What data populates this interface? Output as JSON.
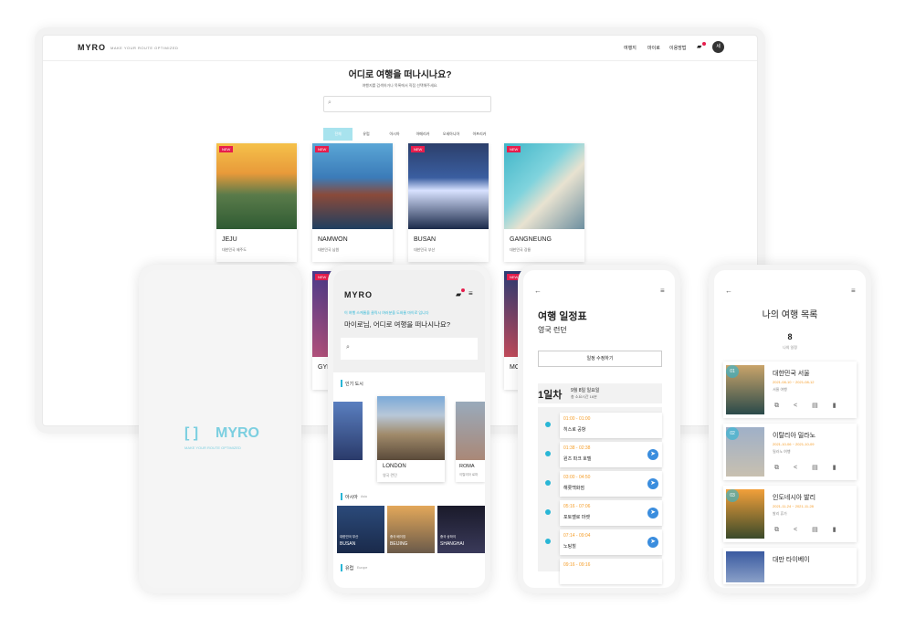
{
  "desktop": {
    "logo": "MYRO",
    "tagline": "MAKE YOUR ROUTE OPTIMIZED",
    "nav": [
      "여행지",
      "마이로",
      "이용방법"
    ],
    "avatar": "세",
    "heading": "어디로 여행을 떠나시나요?",
    "subheading": "여행지를 검색하거나 목록에서 직접 선택해주세요.",
    "search_placeholder": "",
    "filters": [
      "전체",
      "유럽",
      "아시아",
      "아메리카",
      "오세아니아",
      "아프리카"
    ],
    "badge": "NEW",
    "cards": [
      {
        "name": "JEJU",
        "sub": "대한민국 제주도"
      },
      {
        "name": "NAMWON",
        "sub": "대한민국 남원"
      },
      {
        "name": "BUSAN",
        "sub": "대한민국 부산"
      },
      {
        "name": "GANGNEUNG",
        "sub": "대한민국 강릉"
      }
    ],
    "row2_names": [
      "GYI",
      "MO"
    ]
  },
  "splash": {
    "logo": "MYRO",
    "tagline": "MAKE YOUR ROUTE OPTIMIZED"
  },
  "home": {
    "logo": "MYRO",
    "notice": "이 여행 스케줄을 클릭시 여러분을 도와줄 마이로 입니다",
    "heading": "마이로님, 어디로 여행을 떠나시나요?",
    "popular": "인기 도시",
    "main_city": "LONDON",
    "main_city_sub": "영국 런던",
    "right_city": "ROMA",
    "right_city_sub": "이탈리아 로마",
    "asia_label": "아시아",
    "asia_sub": "Asia",
    "asia_cities": [
      {
        "ko": "대한민국 부산",
        "en": "BUSAN"
      },
      {
        "ko": "중국 베이징",
        "en": "BEIJING"
      },
      {
        "ko": "중국 상하이",
        "en": "SHANGHAI"
      }
    ],
    "europe_label": "유럽",
    "europe_sub": "Europe"
  },
  "schedule": {
    "title": "여행 일정표",
    "subtitle": "영국 런던",
    "edit_button": "일정 수정하기",
    "day": "1일차",
    "date": "9월 8일 일요일",
    "total": "총 소요시간 16분",
    "items": [
      {
        "time": "01:00 - 01:00",
        "place": "히스로 공항"
      },
      {
        "time": "01:38 - 02:38",
        "place": "윈즈 파크 호텔"
      },
      {
        "time": "03:00 - 04:50",
        "place": "해롯백화점"
      },
      {
        "time": "05:16 - 07:06",
        "place": "포토벨로 마켓"
      },
      {
        "time": "07:14 - 09:04",
        "place": "노팅힐"
      },
      {
        "time": "09:16 - 09:16",
        "place": ""
      }
    ]
  },
  "trips": {
    "title": "나의 여행 목록",
    "count": "8",
    "count_label": "나의 일정",
    "items": [
      {
        "num": "01",
        "title": "대한민국 서울",
        "date": "2021-08-10 ~ 2021-08-12",
        "sub": "서울 여행"
      },
      {
        "num": "02",
        "title": "이탈리아 밀라노",
        "date": "2021-10-06 ~ 2021-10-09",
        "sub": "밀라노 여행"
      },
      {
        "num": "03",
        "title": "인도네시아 발리",
        "date": "2021-11-24 ~ 2021-11-28",
        "sub": "발리 휴가"
      },
      {
        "num": "04",
        "title": "대만 타이베이",
        "date": "",
        "sub": ""
      }
    ]
  },
  "colors": {
    "accent": "#29b6d6",
    "orange": "#f59e2b",
    "badge": "#e61e4d",
    "nav_btn": "#3a8dde"
  }
}
